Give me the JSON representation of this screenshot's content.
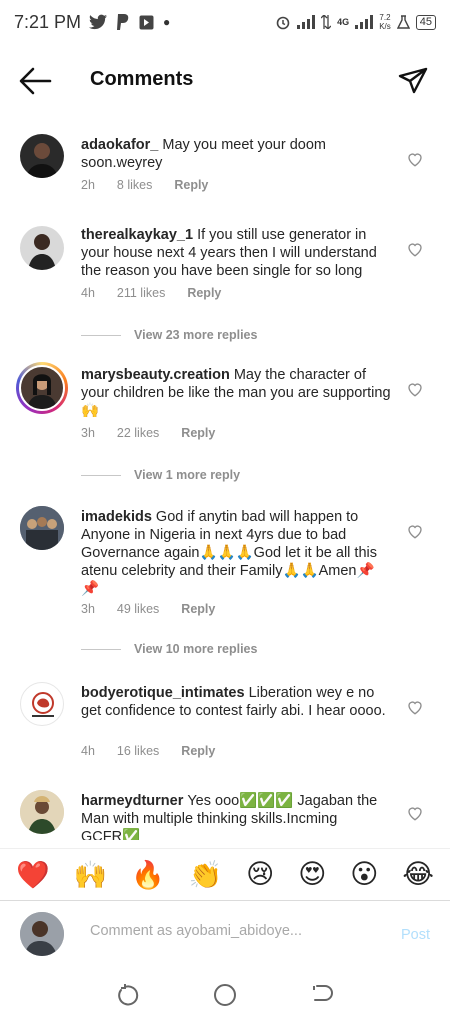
{
  "status_bar": {
    "time": "7:21 PM",
    "network_label": "4G",
    "speed_value": "7.2",
    "speed_unit": "K/s",
    "battery": "45"
  },
  "header": {
    "title": "Comments"
  },
  "comments": [
    {
      "username": "adaokafor_",
      "text": "May you meet your doom soon.weyrey",
      "time": "2h",
      "likes": "8 likes",
      "reply": "Reply"
    },
    {
      "username": "therealkaykay_1",
      "text": "If you still use generator in your house next 4 years then I will understand the  reason you have been single for so long",
      "time": "4h",
      "likes": "211 likes",
      "reply": "Reply",
      "view_replies": "View 23 more replies"
    },
    {
      "username": "marysbeauty.creation",
      "text": "May the character of your children be like the man you are supporting 🙌",
      "time": "3h",
      "likes": "22 likes",
      "reply": "Reply",
      "view_replies": "View 1 more reply"
    },
    {
      "username": "imadekids",
      "text": "God if anytin bad will happen to Anyone in Nigeria in next 4yrs due to bad Governance again🙏🙏🙏God let it be all this atenu celebrity and their Family🙏🙏Amen📌📌",
      "time": "3h",
      "likes": "49 likes",
      "reply": "Reply",
      "view_replies": "View 10 more replies"
    },
    {
      "username": "bodyerotique_intimates",
      "text": "Liberation wey e no get confidence to contest fairly abi. I hear oooo.",
      "time": "4h",
      "likes": "16 likes",
      "reply": "Reply"
    },
    {
      "username": "harmeydturner",
      "text": "Yes ooo✅✅✅ Jagaban the Man with multiple thinking skills.Incming GCFR✅"
    }
  ],
  "emoji_bar": [
    "❤️",
    "🙌",
    "🔥",
    "👏",
    "😢",
    "😍",
    "😮",
    "😂"
  ],
  "composer": {
    "placeholder": "Comment as ayobami_abidoye...",
    "post_label": "Post"
  },
  "colors": {
    "accent_disabled": "#b2dffc",
    "secondary_text": "#8e8e8e",
    "heart_red": "#ed4956"
  }
}
